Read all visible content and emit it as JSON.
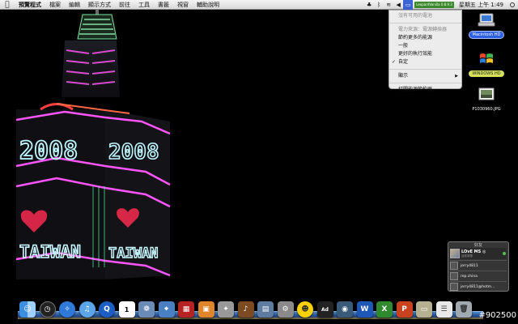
{
  "menubar": {
    "app_name": "預覽程式",
    "items": [
      "檔案",
      "編輯",
      "顯示方式",
      "前往",
      "工具",
      "書籤",
      "視窗",
      "輔助說明"
    ],
    "tray_badge": "LeopardVanilla 0.8.9.3",
    "clock": "星期五 上午 1:49"
  },
  "battery_menu": {
    "items": [
      {
        "label": "沒有可用的電池",
        "disabled": true
      },
      {
        "label": "電力來源：電源轉換器",
        "disabled": true
      },
      {
        "label": "節約更多的能源",
        "disabled": false
      },
      {
        "label": "一般",
        "disabled": false
      },
      {
        "label": "更好的執行效能",
        "disabled": false
      },
      {
        "label": "自定",
        "disabled": false,
        "checked": true
      },
      {
        "label": "顯示",
        "disabled": false,
        "submenu": true
      },
      {
        "label": "打開能源節約器…",
        "disabled": false
      }
    ]
  },
  "desktop_icons": {
    "mac_hd": "Macintosh HD",
    "win_hd": "WINDOWS HD",
    "jpg": "P1030960.JPG"
  },
  "building_signs": {
    "year": "2008",
    "country": "TAIWAN"
  },
  "buddy_panel": {
    "title": "好友",
    "user_name": "LOvE MS ◎",
    "user_status": "目前狀態",
    "contacts": [
      "jerry4811",
      "rep.china",
      "jerry4811@hotm..."
    ]
  },
  "dock": {
    "icons": [
      "finder-icon",
      "dashboard-icon",
      "safari-icon",
      "itunes-icon",
      "quicktime-icon",
      "ical-icon",
      "iphoto-icon",
      "preview-icon",
      "photo-booth-icon",
      "iphoto2-icon",
      "imovie-icon",
      "garageband-icon",
      "spaces-icon",
      "system-preferences-icon",
      "messenger-icon",
      "adium-icon",
      "camera-icon",
      "word-icon",
      "excel-icon",
      "powerpoint-icon",
      "desktop-icon",
      "stack-icon",
      "trash-icon"
    ],
    "calendar_day": "1",
    "ad_label": "Ad",
    "app_letters": [
      "W",
      "X",
      "P"
    ]
  },
  "watermark": "#902500"
}
